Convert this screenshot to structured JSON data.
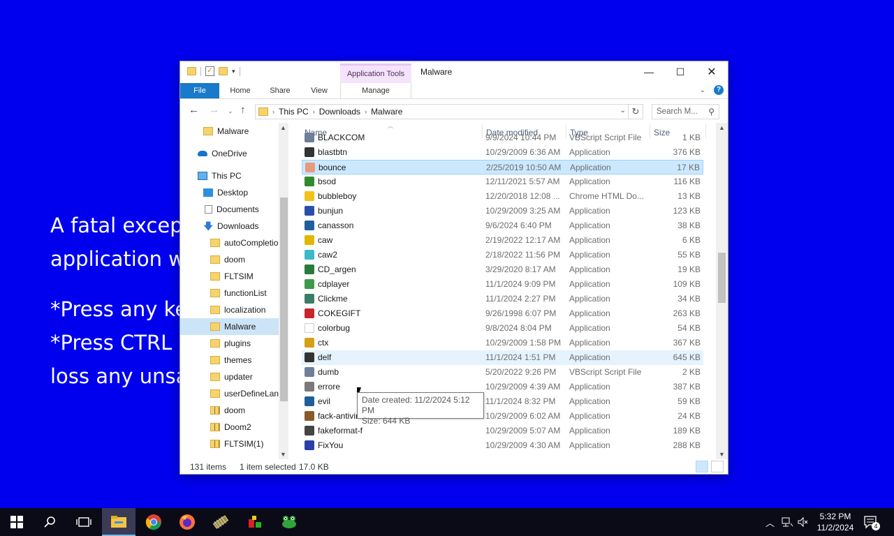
{
  "background": {
    "color": "#0000ee",
    "lines": [
      "A fatal except",
      "application wi",
      "*Press any ke",
      "*Press CTRL",
      "loss any unsa"
    ]
  },
  "window": {
    "title": "Malware",
    "context_tab_group": "Application Tools",
    "tabs": {
      "file": "File",
      "home": "Home",
      "share": "Share",
      "view": "View",
      "manage": "Manage"
    },
    "address": [
      "This PC",
      "Downloads",
      "Malware"
    ],
    "search_placeholder": "Search M...",
    "nav_items": [
      {
        "label": "Malware",
        "icon": "folder-icon"
      },
      {
        "label": "OneDrive",
        "icon": "onedrive-icon"
      },
      {
        "label": "This PC",
        "icon": "this-pc-icon"
      },
      {
        "label": "Desktop",
        "icon": "desktop-icon"
      },
      {
        "label": "Documents",
        "icon": "documents-icon"
      },
      {
        "label": "Downloads",
        "icon": "download-icon"
      },
      {
        "label": "autoCompletion",
        "icon": "folder-icon"
      },
      {
        "label": "doom",
        "icon": "folder-icon"
      },
      {
        "label": "FLTSIM",
        "icon": "folder-icon"
      },
      {
        "label": "functionList",
        "icon": "folder-icon"
      },
      {
        "label": "localization",
        "icon": "folder-icon"
      },
      {
        "label": "Malware",
        "icon": "folder-icon",
        "selected": true
      },
      {
        "label": "plugins",
        "icon": "folder-icon"
      },
      {
        "label": "themes",
        "icon": "folder-icon"
      },
      {
        "label": "updater",
        "icon": "folder-icon"
      },
      {
        "label": "userDefineLang",
        "icon": "folder-icon"
      },
      {
        "label": "doom",
        "icon": "zip-folder-icon"
      },
      {
        "label": "Doom2",
        "icon": "zip-folder-icon"
      },
      {
        "label": "FLTSIM(1)",
        "icon": "zip-folder-icon"
      }
    ],
    "columns": {
      "name": "Name",
      "date": "Date modified",
      "type": "Type",
      "size": "Size"
    },
    "files": [
      {
        "name": "BLACKCOM",
        "date": "9/9/2024 10:44 PM",
        "type": "VBScript Script File",
        "size": "1 KB",
        "icon_color": "#6f7f99"
      },
      {
        "name": "blastbtn",
        "date": "10/29/2009 6:36 AM",
        "type": "Application",
        "size": "376 KB",
        "icon_color": "#333333"
      },
      {
        "name": "bounce",
        "date": "2/25/2019 10:50 AM",
        "type": "Application",
        "size": "17 KB",
        "icon_color": "#e79a7e",
        "selected": true
      },
      {
        "name": "bsod",
        "date": "12/11/2021 5:57 AM",
        "type": "Application",
        "size": "116 KB",
        "icon_color": "#2e8b2e"
      },
      {
        "name": "bubbleboy",
        "date": "12/20/2018 12:08 ...",
        "type": "Chrome HTML Do...",
        "size": "13 KB",
        "icon_color": "#f2c21b"
      },
      {
        "name": "bunjun",
        "date": "10/29/2009 3:25 AM",
        "type": "Application",
        "size": "123 KB",
        "icon_color": "#2b4fa8"
      },
      {
        "name": "canasson",
        "date": "9/6/2024 6:40 PM",
        "type": "Application",
        "size": "38 KB",
        "icon_color": "#1f5fa0"
      },
      {
        "name": "caw",
        "date": "2/19/2022 12:17 AM",
        "type": "Application",
        "size": "6 KB",
        "icon_color": "#e0b800"
      },
      {
        "name": "caw2",
        "date": "2/18/2022 11:56 PM",
        "type": "Application",
        "size": "55 KB",
        "icon_color": "#3bb9c9"
      },
      {
        "name": "CD_argen",
        "date": "3/29/2020 8:17 AM",
        "type": "Application",
        "size": "19 KB",
        "icon_color": "#2a7a3b"
      },
      {
        "name": "cdplayer",
        "date": "11/1/2024 9:09 PM",
        "type": "Application",
        "size": "109 KB",
        "icon_color": "#3c9a4d"
      },
      {
        "name": "Clickme",
        "date": "11/1/2024 2:27 PM",
        "type": "Application",
        "size": "34 KB",
        "icon_color": "#3a7e68"
      },
      {
        "name": "COKEGIFT",
        "date": "9/26/1998 6:07 PM",
        "type": "Application",
        "size": "263 KB",
        "icon_color": "#c8242b"
      },
      {
        "name": "colorbug",
        "date": "9/8/2024 8:04 PM",
        "type": "Application",
        "size": "54 KB",
        "icon_color": "#ffffff"
      },
      {
        "name": "ctx",
        "date": "10/29/2009 1:58 PM",
        "type": "Application",
        "size": "367 KB",
        "icon_color": "#d4a017"
      },
      {
        "name": "delf",
        "date": "11/1/2024 1:51 PM",
        "type": "Application",
        "size": "645 KB",
        "icon_color": "#333333",
        "hover": true
      },
      {
        "name": "dumb",
        "date": "5/20/2022 9:26 PM",
        "type": "VBScript Script File",
        "size": "2 KB",
        "icon_color": "#6f7f99"
      },
      {
        "name": "errore",
        "date": "10/29/2009 4:39 AM",
        "type": "Application",
        "size": "387 KB",
        "icon_color": "#7a7a7a"
      },
      {
        "name": "evil",
        "date": "11/1/2024 8:32 PM",
        "type": "Application",
        "size": "59 KB",
        "icon_color": "#1e5f99"
      },
      {
        "name": "fack-antivirus",
        "date": "10/29/2009 6:02 AM",
        "type": "Application",
        "size": "24 KB",
        "icon_color": "#8a5a2a"
      },
      {
        "name": "fakeformat-f",
        "date": "10/29/2009 5:07 AM",
        "type": "Application",
        "size": "189 KB",
        "icon_color": "#444444"
      },
      {
        "name": "FixYou",
        "date": "10/29/2009 4:30 AM",
        "type": "Application",
        "size": "288 KB",
        "icon_color": "#2b3fa8"
      }
    ],
    "status": {
      "count": "131 items",
      "selected": "1 item selected",
      "size": "17.0 KB"
    },
    "tooltip": {
      "created": "Date created: 11/2/2024 5:12 PM",
      "size": "Size: 644 KB"
    }
  },
  "taskbar": {
    "time": "5:32 PM",
    "date": "11/2/2024",
    "notification_count": "4"
  }
}
